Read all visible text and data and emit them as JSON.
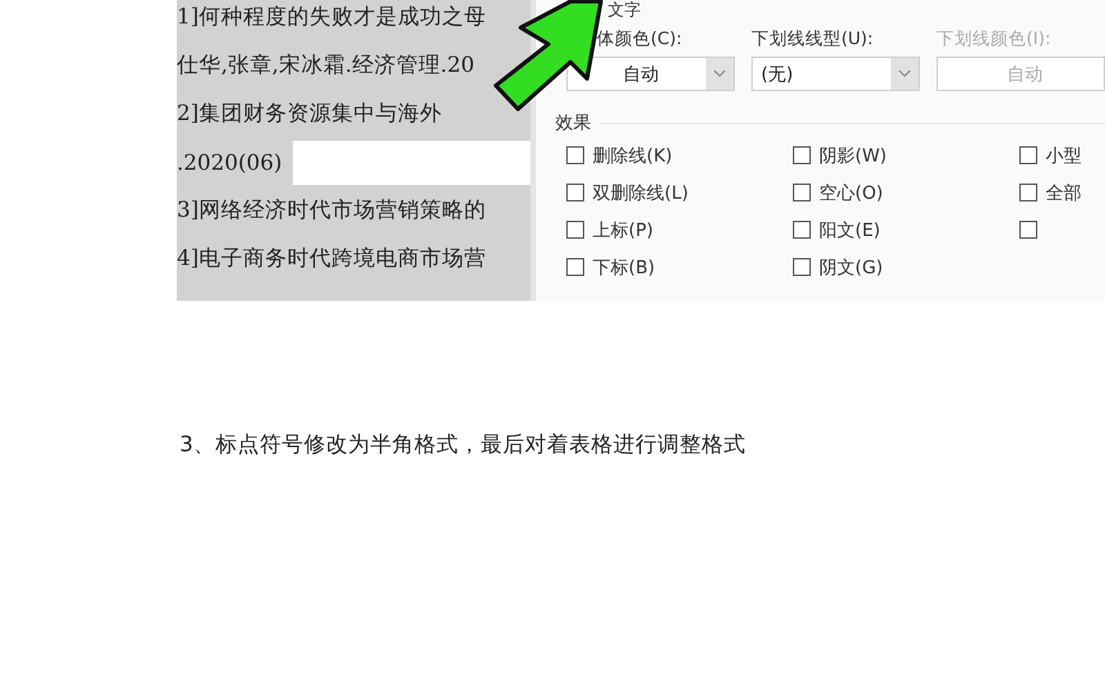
{
  "document": {
    "lines": [
      {
        "text": "1]何种程度的失败才是成功之母",
        "kind": "text"
      },
      {
        "text": "仕华,张章,宋冰霜.经济管理.20",
        "kind": "text"
      },
      {
        "text": "2]集团财务资源集中与海外",
        "kind": "text"
      },
      {
        "text": ".2020(06)",
        "kind": "blank"
      },
      {
        "text": "3]网络经济时代市场营销策略的",
        "kind": "text"
      },
      {
        "text": "4]电子商务时代跨境电商市场营",
        "kind": "text"
      }
    ]
  },
  "dialog": {
    "section": "文字",
    "dropdowns": [
      {
        "label": "体颜色(C):",
        "value": "自动",
        "disabled": false
      },
      {
        "label": "下划线线型(U):",
        "value": "(无)",
        "disabled": false
      },
      {
        "label": "下划线颜色(I):",
        "value": "自动",
        "disabled": true
      }
    ],
    "effects_title": "效果",
    "effect_columns": [
      {
        "items": [
          {
            "label": "删除线(K)",
            "checked": false
          },
          {
            "label": "双删除线(L)",
            "checked": false
          },
          {
            "label": "上标(P)",
            "checked": false
          },
          {
            "label": "下标(B)",
            "checked": false
          }
        ]
      },
      {
        "items": [
          {
            "label": "阴影(W)",
            "checked": false
          },
          {
            "label": "空心(O)",
            "checked": false
          },
          {
            "label": "阳文(E)",
            "checked": false
          },
          {
            "label": "阴文(G)",
            "checked": false
          }
        ]
      },
      {
        "items": [
          {
            "label": "小型",
            "checked": false
          },
          {
            "label": "全部",
            "checked": false
          },
          {
            "checked": false
          }
        ]
      }
    ]
  },
  "caption": "3、标点符号修改为半角格式，最后对着表格进行调整格式"
}
